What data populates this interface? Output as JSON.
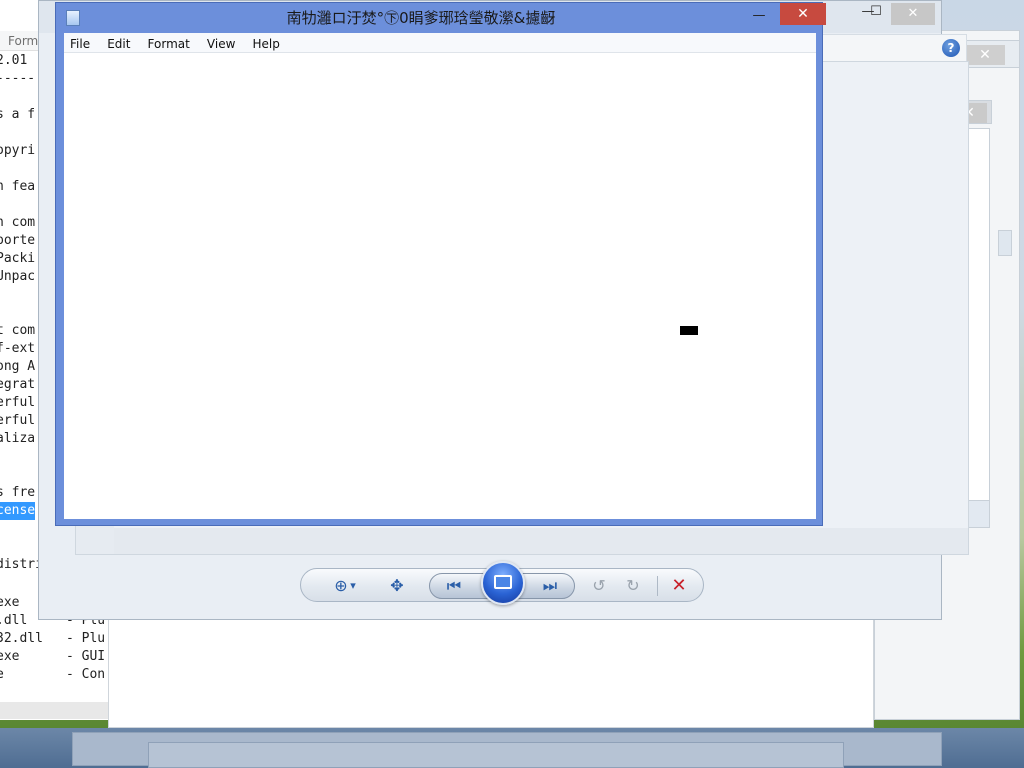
{
  "desktop": {
    "bg_colors": [
      "#c9d7e6",
      "#6e9a3e"
    ]
  },
  "background_editor": {
    "menu_label": "Form",
    "lines": [
      "2.01",
      "-----",
      "",
      "s a f",
      "",
      "opyri",
      "",
      "n fea",
      "",
      "h com",
      "porte",
      "Packi",
      "Unpac",
      "",
      "",
      "t com",
      "f-ext",
      "ong A",
      "egrat",
      "erful",
      "erful",
      "aliza",
      "",
      "",
      "s fre",
      "cense",
      "",
      "",
      "distri"
    ],
    "highlighted_line_index": 25,
    "file_list": [
      {
        "name": "exe",
        "desc": ""
      },
      {
        "name": ".dll",
        "desc": "- Plu"
      },
      {
        "name": "32.dll",
        "desc": "- Plu"
      },
      {
        "name": "exe",
        "desc": "- GUI"
      },
      {
        "name": "e",
        "desc": "- Con"
      }
    ]
  },
  "middle_window": {
    "minimize_glyph": "—",
    "maximize_glyph": "☐",
    "close_glyph": "✕",
    "help_glyph": "?"
  },
  "right_windows": {
    "close_glyph": "✕",
    "maximize_glyph": "☐"
  },
  "photo_viewer": {
    "controls": {
      "zoom_icon": "zoom-icon",
      "zoom_dropdown_glyph": "▾",
      "fit_icon": "actual-size-icon",
      "previous_icon": "previous-icon",
      "slideshow_icon": "slideshow-icon",
      "next_icon": "next-icon",
      "rotate_ccw_icon": "rotate-counterclockwise-icon",
      "rotate_cw_icon": "rotate-clockwise-icon",
      "delete_icon": "delete-icon"
    },
    "glyphs": {
      "zoom": "⊕",
      "dropdown": "▾",
      "fit": "✥",
      "previous": "⏮",
      "next": "⏭",
      "rotate_ccw": "↺",
      "rotate_cw": "↻",
      "delete": "✕"
    }
  },
  "notepad": {
    "title": "南牞灉ロ汙焚°㊦0睊爹琊琀瑩敬瀠&攄齖",
    "menu": [
      "File",
      "Edit",
      "Format",
      "View",
      "Help"
    ],
    "content": "",
    "minimize_glyph": "—",
    "maximize_glyph": "☐",
    "close_glyph": "✕"
  }
}
